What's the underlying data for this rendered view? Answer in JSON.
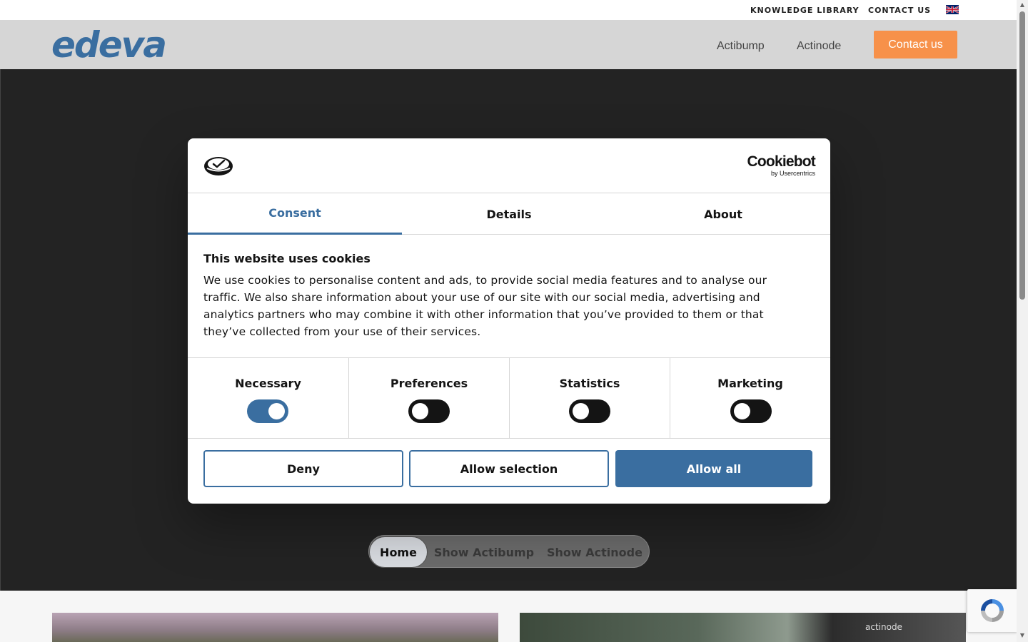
{
  "topbar": {
    "knowledge_library": "KNOWLEDGE LIBRARY",
    "contact_us": "CONTACT US",
    "language_flag_icon": "uk-flag-icon"
  },
  "header": {
    "logo_text": "edeva",
    "nav": [
      "Actibump",
      "Actinode"
    ],
    "contact_button": "Contact us",
    "colors": {
      "accent": "#f7914a",
      "logo": "#3a6ea0"
    }
  },
  "hero": {
    "pills": [
      "Home",
      "Show Actibump",
      "Show Actinode"
    ],
    "active_pill": "Home"
  },
  "cards": {
    "right_card_label": "actinode"
  },
  "cookie_dialog": {
    "brand_main": "Cookiebot",
    "brand_sub": "by Usercentrics",
    "tabs": [
      "Consent",
      "Details",
      "About"
    ],
    "active_tab": "Consent",
    "title": "This website uses cookies",
    "text": "We use cookies to personalise content and ads, to provide social media features and to analyse our traffic. We also share information about your use of our site with our social media, advertising and analytics partners who may combine it with other information that you’ve provided to them or that they’ve collected from your use of their services.",
    "categories": [
      {
        "label": "Necessary",
        "enabled": true
      },
      {
        "label": "Preferences",
        "enabled": false
      },
      {
        "label": "Statistics",
        "enabled": false
      },
      {
        "label": "Marketing",
        "enabled": false
      }
    ],
    "buttons": {
      "deny": "Deny",
      "allow_selection": "Allow selection",
      "allow_all": "Allow all"
    },
    "colors": {
      "primary": "#3a6ea0",
      "toggle_off": "#141414"
    }
  }
}
